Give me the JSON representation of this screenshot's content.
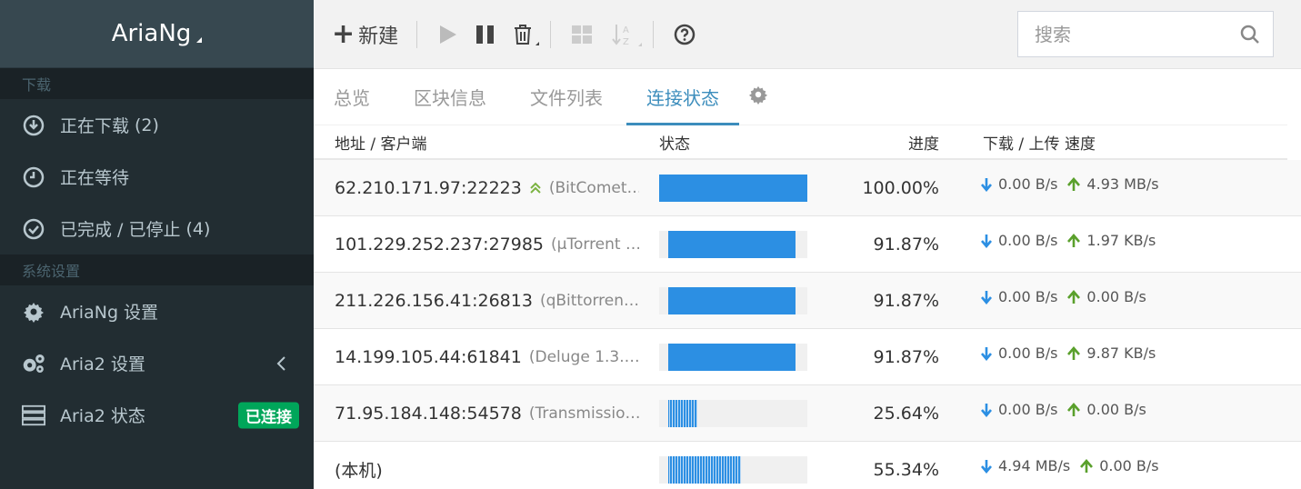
{
  "sidebar": {
    "logo": "AriaNg",
    "sections": [
      {
        "header": "下载"
      },
      {
        "header": "系统设置"
      }
    ],
    "items": [
      {
        "label": "正在下载",
        "count": "(2)"
      },
      {
        "label": "正在等待",
        "count": ""
      },
      {
        "label": "已完成 / 已停止",
        "count": "(4)"
      },
      {
        "label": "AriaNg 设置",
        "count": ""
      },
      {
        "label": "Aria2 设置",
        "count": ""
      },
      {
        "label": "Aria2 状态",
        "count": ""
      }
    ],
    "status_badge": "已连接"
  },
  "toolbar": {
    "new_label": "新建",
    "search_placeholder": "搜索"
  },
  "tabs": [
    "总览",
    "区块信息",
    "文件列表",
    "连接状态"
  ],
  "active_tab": 3,
  "table": {
    "headers": {
      "address": "地址 / 客户端",
      "status": "状态",
      "progress": "进度",
      "speed": "下载 / 上传 速度"
    },
    "rows": [
      {
        "address": "62.210.171.97:22223",
        "client": "(BitComet…",
        "seed": true,
        "progress": 100.0,
        "progress_text": "100.00%",
        "download": "0.00 B/s",
        "upload": "4.93 MB/s"
      },
      {
        "address": "101.229.252.237:27985",
        "client": "(µTorrent …",
        "seed": false,
        "progress": 91.87,
        "progress_text": "91.87%",
        "download": "0.00 B/s",
        "upload": "1.97 KB/s"
      },
      {
        "address": "211.226.156.41:26813",
        "client": "(qBittorren…",
        "seed": false,
        "progress": 91.87,
        "progress_text": "91.87%",
        "download": "0.00 B/s",
        "upload": "0.00 B/s"
      },
      {
        "address": "14.199.105.44:61841",
        "client": "(Deluge 1.3.…",
        "seed": false,
        "progress": 91.87,
        "progress_text": "91.87%",
        "download": "0.00 B/s",
        "upload": "9.87 KB/s"
      },
      {
        "address": "71.95.184.148:54578",
        "client": "(Transmissio…",
        "seed": false,
        "progress": 25.64,
        "progress_text": "25.64%",
        "download": "0.00 B/s",
        "upload": "0.00 B/s"
      },
      {
        "address": "(本机)",
        "client": "",
        "seed": false,
        "progress": 55.34,
        "progress_text": "55.34%",
        "download": "4.94 MB/s",
        "upload": "0.00 B/s"
      }
    ]
  },
  "colors": {
    "sidebar_bg": "#222d32",
    "accent": "#3c8dbc",
    "progress": "#2c8fe3",
    "download_arrow": "#2c8fe3",
    "upload_arrow": "#5aa02c",
    "badge": "#00a65a"
  },
  "icons": {
    "downloading": "download-circle-icon",
    "waiting": "clock-icon",
    "stopped": "check-circle-icon",
    "ariang_settings": "gear-icon",
    "aria2_settings": "gears-icon",
    "aria2_status": "server-icon"
  }
}
